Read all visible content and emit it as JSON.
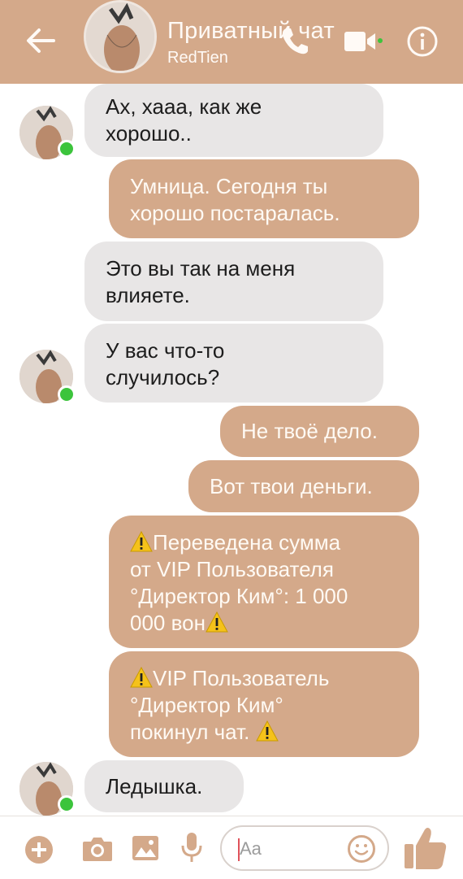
{
  "header": {
    "title": "Приватный чат",
    "subtitle": "RedTien",
    "accent_color": "#d4a98a",
    "icons": [
      "back-arrow-icon",
      "phone-icon",
      "video-camera-icon",
      "info-icon"
    ]
  },
  "messages": [
    {
      "direction": "incoming",
      "show_avatar": true,
      "text": [
        "Ах, хааа, как же",
        "хорошо.."
      ]
    },
    {
      "direction": "outgoing",
      "text": [
        "Умница. Сегодня ты",
        "хорошо постаралась."
      ]
    },
    {
      "direction": "incoming",
      "show_avatar": false,
      "text": [
        "Это вы так на меня",
        "влияете."
      ]
    },
    {
      "direction": "incoming",
      "show_avatar": true,
      "text": [
        "У вас что-то",
        "случилось?"
      ]
    },
    {
      "direction": "outgoing",
      "text": [
        "Не твоё дело."
      ]
    },
    {
      "direction": "outgoing",
      "text": [
        "Вот твои деньги."
      ]
    },
    {
      "direction": "outgoing",
      "system": true,
      "text": [
        "Переведена сумма",
        "от VIP Пользователя",
        "°Директор Ким°: 1 000",
        "000 вон"
      ]
    },
    {
      "direction": "outgoing",
      "system": true,
      "text": [
        "VIP Пользователь",
        "°Директор Ким°",
        "покинул чат."
      ]
    },
    {
      "direction": "incoming",
      "show_avatar": true,
      "text": [
        "Ледышка."
      ]
    }
  ],
  "composer": {
    "placeholder": "Aa",
    "icons": [
      "plus-icon",
      "camera-icon",
      "image-icon",
      "microphone-icon",
      "emoji-icon",
      "thumbs-up-icon"
    ]
  },
  "colors": {
    "incoming_bubble": "#e8e6e6",
    "outgoing_bubble": "#d4a98a",
    "online": "#3cc43c",
    "warning": "#f5c21a"
  }
}
